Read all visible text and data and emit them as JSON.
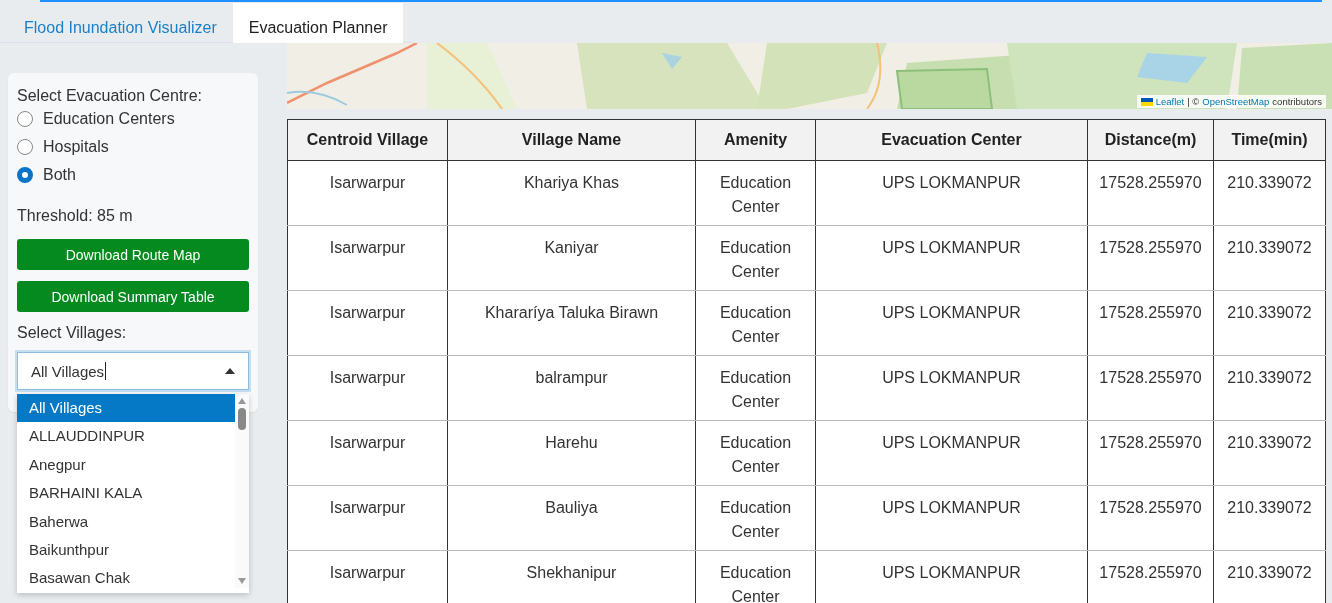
{
  "tabs": [
    {
      "label": "Flood Inundation Visualizer",
      "selected": false
    },
    {
      "label": "Evacuation Planner",
      "selected": true
    }
  ],
  "sidebar": {
    "centre_label": "Select Evacuation Centre:",
    "centre_options": [
      {
        "label": "Education Centers",
        "selected": false
      },
      {
        "label": "Hospitals",
        "selected": false
      },
      {
        "label": "Both",
        "selected": true
      }
    ],
    "threshold": "Threshold: 85 m",
    "buttons": [
      "Download Route Map",
      "Download Summary Table"
    ],
    "villages_label": "Select Villages:",
    "villages_select": {
      "value": "All Villages",
      "expanded": true,
      "options": [
        {
          "label": "All Villages",
          "selected": true
        },
        {
          "label": "ALLAUDDINPUR",
          "selected": false
        },
        {
          "label": "Anegpur",
          "selected": false
        },
        {
          "label": "BARHAINI KALA",
          "selected": false
        },
        {
          "label": "Baherwa",
          "selected": false
        },
        {
          "label": "Baikunthpur",
          "selected": false
        },
        {
          "label": "Basawan Chak",
          "selected": false
        }
      ]
    }
  },
  "map": {
    "kind": "picture",
    "attribution": {
      "leaflet": "Leaflet",
      "separator": "| ©",
      "osm": "OpenStreetMap",
      "suffix": "contributors"
    }
  },
  "table": {
    "columns": [
      "Centroid Village",
      "Village Name",
      "Amenity",
      "Evacuation Center",
      "Distance(m)",
      "Time(min)"
    ],
    "rows": [
      [
        "Isarwarpur",
        "Khariya Khas",
        "Education Center",
        "UPS LOKMANPUR",
        "17528.255970",
        "210.339072"
      ],
      [
        "Isarwarpur",
        "Kaniyar",
        "Education Center",
        "UPS LOKMANPUR",
        "17528.255970",
        "210.339072"
      ],
      [
        "Isarwarpur",
        "Khararíya Taluka Birawn",
        "Education Center",
        "UPS LOKMANPUR",
        "17528.255970",
        "210.339072"
      ],
      [
        "Isarwarpur",
        "balrampur",
        "Education Center",
        "UPS LOKMANPUR",
        "17528.255970",
        "210.339072"
      ],
      [
        "Isarwarpur",
        "Harehu",
        "Education Center",
        "UPS LOKMANPUR",
        "17528.255970",
        "210.339072"
      ],
      [
        "Isarwarpur",
        "Bauliya",
        "Education Center",
        "UPS LOKMANPUR",
        "17528.255970",
        "210.339072"
      ],
      [
        "Isarwarpur",
        "Shekhanipur",
        "Education Center",
        "UPS LOKMANPUR",
        "17528.255970",
        "210.339072"
      ]
    ]
  }
}
